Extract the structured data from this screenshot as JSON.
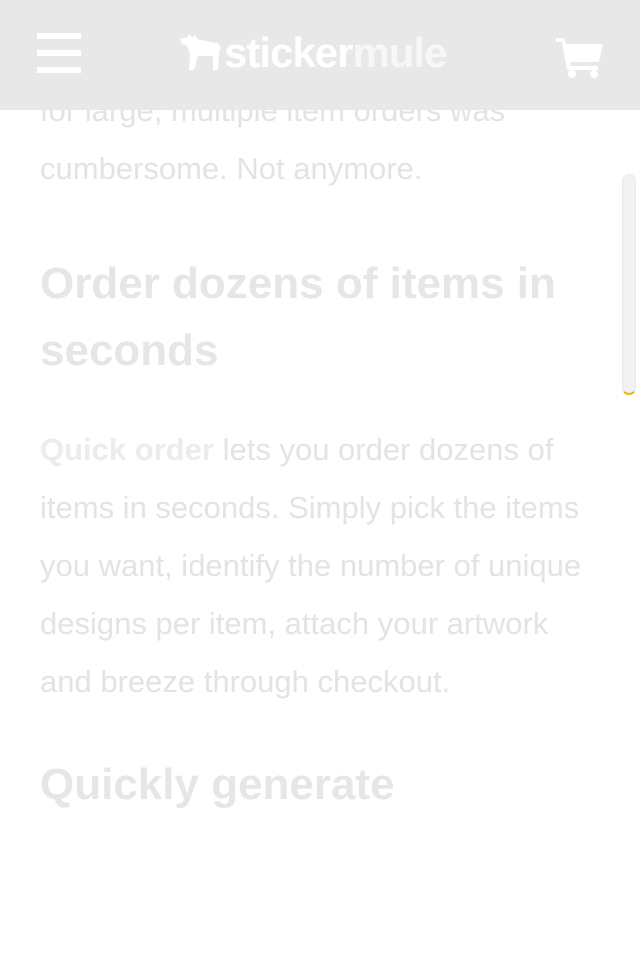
{
  "header": {
    "logo_part1": "sticker",
    "logo_part2": "mule",
    "menu_icon": "hamburger-icon",
    "cart_icon": "shopping-cart-icon"
  },
  "article": {
    "intro_lines": [
      "for large, multiple item orders was",
      "cumbersome. Not anymore."
    ],
    "section1": {
      "heading": "Order dozens of items in seconds",
      "lead_bold": "Quick order",
      "body": " lets you order dozens of items in seconds. Simply pick the items you want, identify the number of unique designs per item, attach your artwork and breeze through checkout."
    },
    "section2": {
      "heading": "Quickly generate"
    }
  },
  "colors": {
    "header_bg": "#e8e8e8",
    "text": "#e3e3e3",
    "scroll_accent": "#e1b800"
  }
}
